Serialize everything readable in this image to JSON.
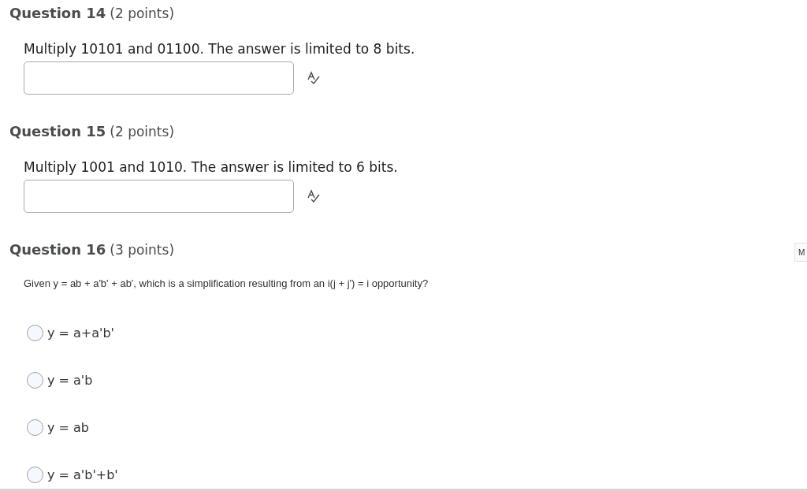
{
  "questions": [
    {
      "kind": "short_answer",
      "title": "Question 14",
      "points": "(2 points)",
      "prompt": "Multiply 10101 and 01100.  The answer is limited to 8 bits."
    },
    {
      "kind": "short_answer",
      "title": "Question 15",
      "points": "(2 points)",
      "prompt": "Multiply 1001 and 1010.  The answer is limited to 6 bits."
    },
    {
      "kind": "multiple_choice",
      "title": "Question 16",
      "points": "(3 points)",
      "prompt": "Given y = ab + a'b' + ab', which is a simplification resulting from an i(j + j') = i opportunity?",
      "options": [
        {
          "label": "y = a+a'b'",
          "selected": false
        },
        {
          "label": "y = a'b",
          "selected": false
        },
        {
          "label": "y = ab",
          "selected": false
        },
        {
          "label": "y = a'b'+b'",
          "selected": false
        }
      ]
    }
  ],
  "side_tab": "M"
}
